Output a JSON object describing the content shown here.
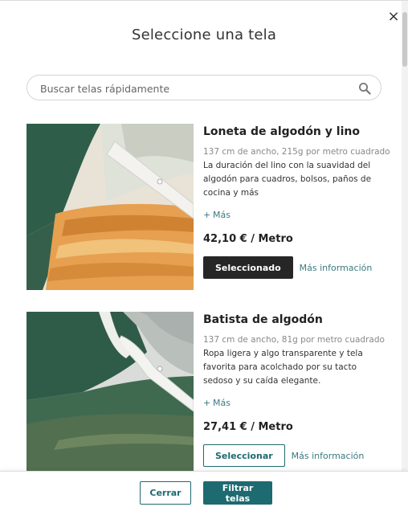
{
  "modal": {
    "title": "Seleccione una tela",
    "close_symbol": "×"
  },
  "search": {
    "placeholder": "Buscar telas rápidamente",
    "value": "",
    "icon": "search-icon"
  },
  "fabrics": [
    {
      "name": "Loneta de algodón y lino",
      "spec": "137 cm de ancho, 215g por metro cuadrado",
      "description": "La duración del lino con la suavidad del algodón para cuadros, bolsos, paños de cocina y más",
      "more_label": "Más",
      "price": "42,10 € / Metro",
      "button_label": "Seleccionado",
      "button_state": "selected",
      "info_label": "Más información"
    },
    {
      "name": "Batista de algodón",
      "spec": "137 cm de ancho, 81g por metro cuadrado",
      "description": "Ropa ligera y algo transparente y tela favorita para acolchado por su tacto sedoso y su caída elegante.",
      "more_label": "Más",
      "price": "27,41 € / Metro",
      "button_label": "Seleccionar",
      "button_state": "unselected",
      "info_label": "Más información"
    }
  ],
  "footer": {
    "cancel_label": "Cerrar",
    "filter_label": "Filtrar telas"
  },
  "colors": {
    "accent": "#1e6a71",
    "selected_button": "#262626",
    "link": "#3c7a80"
  }
}
